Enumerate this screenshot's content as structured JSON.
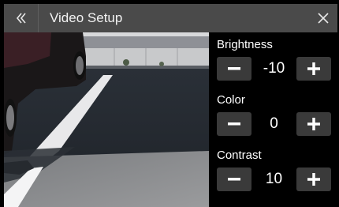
{
  "header": {
    "title": "Video Setup",
    "back_icon": "double-chevron-left-icon",
    "close_icon": "close-icon"
  },
  "settings": [
    {
      "label": "Brightness",
      "value": "-10"
    },
    {
      "label": "Color",
      "value": "0"
    },
    {
      "label": "Contrast",
      "value": "10"
    }
  ],
  "colors": {
    "header_bg": "#4a4a4a",
    "button_bg": "#3a3a3a",
    "panel_bg": "#000000",
    "text": "#ffffff"
  }
}
